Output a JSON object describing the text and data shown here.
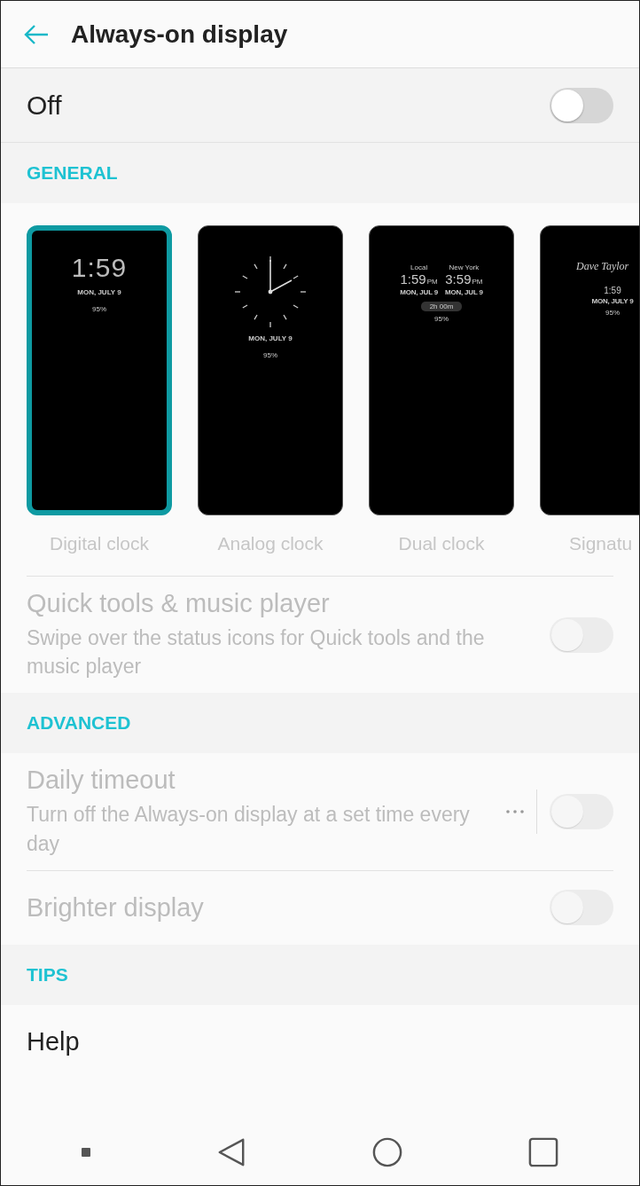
{
  "header": {
    "title": "Always-on display"
  },
  "master": {
    "label": "Off",
    "on": false
  },
  "sections": [
    {
      "heading": "GENERAL",
      "styles": [
        {
          "label": "Digital clock",
          "selected": true,
          "kind": "digital",
          "time": "1:59",
          "date": "MON, JULY 9",
          "battery": "95%"
        },
        {
          "label": "Analog clock",
          "selected": false,
          "kind": "analog",
          "date": "MON, JULY 9",
          "battery": "95%"
        },
        {
          "label": "Dual clock",
          "selected": false,
          "kind": "dual",
          "clocks": [
            {
              "city": "Local",
              "time": "1:59",
              "ampm": "PM",
              "date": "MON, JUL 9"
            },
            {
              "city": "New York",
              "time": "3:59",
              "ampm": "PM",
              "date": "MON, JUL 9"
            }
          ],
          "difference": "2h 00m",
          "battery": "95%"
        },
        {
          "label": "Signatu",
          "selected": false,
          "kind": "signature",
          "signature": "Dave Taylor",
          "time": "1:59",
          "date": "MON, JULY 9",
          "battery": "95%"
        }
      ],
      "items": [
        {
          "title": "Quick tools & music player",
          "subtitle": "Swipe over the status icons for Quick tools and the music player",
          "on": false,
          "disabled": true
        }
      ]
    },
    {
      "heading": "ADVANCED",
      "items": [
        {
          "title": "Daily timeout",
          "subtitle": "Turn off the Always-on display at a set time every day",
          "on": false,
          "disabled": true,
          "menu": true
        },
        {
          "title": "Brighter display",
          "on": false,
          "disabled": true
        }
      ]
    },
    {
      "heading": "TIPS",
      "items": [
        {
          "title": "Help",
          "disabled": false
        }
      ]
    }
  ]
}
